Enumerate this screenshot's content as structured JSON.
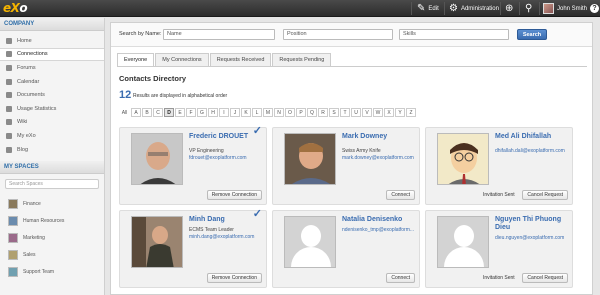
{
  "topbar": {
    "logo_main": "eX",
    "logo_tail": "o",
    "edit_label": "Edit",
    "admin_label": "Administration",
    "user_name": "John Smith",
    "help_label": "?"
  },
  "sidebar": {
    "company_header": "COMPANY",
    "items": [
      {
        "label": "Home"
      },
      {
        "label": "Connections"
      },
      {
        "label": "Forums"
      },
      {
        "label": "Calendar"
      },
      {
        "label": "Documents"
      },
      {
        "label": "Usage Statistics"
      },
      {
        "label": "Wiki"
      },
      {
        "label": "My eXo"
      },
      {
        "label": "Blog"
      }
    ],
    "spaces_header": "MY SPACES",
    "search_placeholder": "Search Spaces",
    "spaces": [
      {
        "label": "Finance",
        "color": "#8a7a5c"
      },
      {
        "label": "Human Resources",
        "color": "#6b8cae"
      },
      {
        "label": "Marketing",
        "color": "#9a6a8a"
      },
      {
        "label": "Sales",
        "color": "#b0a070"
      },
      {
        "label": "Support Team",
        "color": "#70a0b0"
      }
    ]
  },
  "search": {
    "label": "Search by Name:",
    "name_value": "Name",
    "position_value": "Position",
    "skills_value": "Skills",
    "button": "Search"
  },
  "tabs": [
    "Everyone",
    "My Connections",
    "Requests Received",
    "Requests Pending"
  ],
  "directory": {
    "title": "Contacts Directory",
    "count": "12",
    "count_text": "Results are displayed in alphabetical order",
    "letters": [
      "All",
      "A",
      "B",
      "C",
      "D",
      "E",
      "F",
      "G",
      "H",
      "I",
      "J",
      "K",
      "L",
      "M",
      "N",
      "O",
      "P",
      "Q",
      "R",
      "S",
      "T",
      "U",
      "V",
      "W",
      "X",
      "Y",
      "Z"
    ],
    "selected_letter": "D"
  },
  "contacts": [
    {
      "name": "Frederic DROUET",
      "position": "VP Engineering",
      "email": "fdrouet@exoplatform.com",
      "action": "Remove Connection",
      "status": "",
      "connected": true
    },
    {
      "name": "Mark Downey",
      "position": "Swiss Army Knife",
      "email": "mark.downey@exoplatform.com",
      "action": "Connect",
      "status": "",
      "connected": false
    },
    {
      "name": "Med Ali Dhifallah",
      "position": "",
      "email": "dhifallah.dali@exoplatform.com",
      "action": "Cancel Request",
      "status": "Invitation Sent",
      "connected": false
    },
    {
      "name": "Minh Dang",
      "position": "ECMS Team Leader",
      "email": "minh.dang@exoplatform.com",
      "action": "Remove Connection",
      "status": "",
      "connected": true
    },
    {
      "name": "Natalia Denisenko",
      "position": "",
      "email": "ndenisenko_tmp@exoplatform...",
      "action": "Connect",
      "status": "",
      "connected": false
    },
    {
      "name": "Nguyen Thi Phuong Dieu",
      "position": "",
      "email": "dieu.nguyen@exoplatform.com",
      "action": "Cancel Request",
      "status": "Invitation Sent",
      "connected": false
    }
  ]
}
